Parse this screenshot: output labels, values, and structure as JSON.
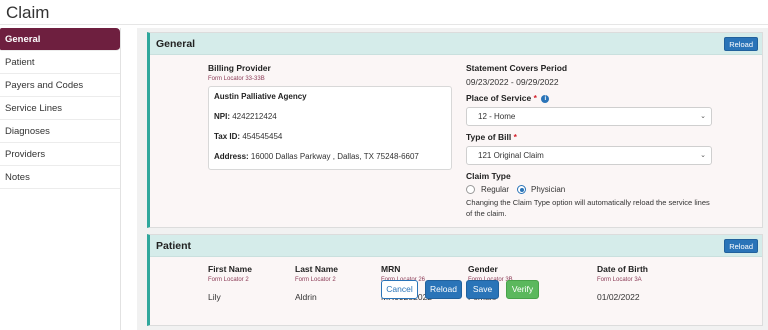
{
  "header": {
    "title": "Claim"
  },
  "sidebar": {
    "items": [
      {
        "label": "General",
        "active": true
      },
      {
        "label": "Patient"
      },
      {
        "label": "Payers and Codes"
      },
      {
        "label": "Service Lines"
      },
      {
        "label": "Diagnoses"
      },
      {
        "label": "Providers"
      },
      {
        "label": "Notes"
      }
    ]
  },
  "general": {
    "title": "General",
    "reload_label": "Reload",
    "billing_provider": {
      "label": "Billing Provider",
      "locator": "Form Locator 33-33B",
      "name": "Austin Palliative Agency",
      "npi_label": "NPI:",
      "npi": "4242212424",
      "tax_label": "Tax ID:",
      "tax_id": "454545454",
      "address_label": "Address:",
      "address": "16000 Dallas Parkway , Dallas, TX 75248-6607"
    },
    "statement_period": {
      "label": "Statement Covers Period",
      "value": "09/23/2022 - 09/29/2022"
    },
    "place_of_service": {
      "label": "Place of Service",
      "required": "*",
      "value": "12 - Home"
    },
    "type_of_bill": {
      "label": "Type of Bill",
      "required": "*",
      "value": "121 Original Claim"
    },
    "claim_type": {
      "label": "Claim Type",
      "options": [
        {
          "label": "Regular",
          "selected": false
        },
        {
          "label": "Physician",
          "selected": true
        }
      ],
      "note": "Changing the Claim Type option will automatically reload the service lines of the claim."
    }
  },
  "patient": {
    "title": "Patient",
    "reload_label": "Reload",
    "fields": [
      {
        "label": "First Name",
        "locator": "Form Locator 2",
        "value": "Lily"
      },
      {
        "label": "Last Name",
        "locator": "Form Locator 2",
        "value": "Aldrin"
      },
      {
        "label": "MRN",
        "locator": "Form Locator 26",
        "value": "MR09282022"
      },
      {
        "label": "Gender",
        "locator": "Form Locator 3B",
        "value": "Female"
      },
      {
        "label": "Date of Birth",
        "locator": "Form Locator 3A",
        "value": "01/02/2022"
      }
    ]
  },
  "footer": {
    "cancel_label": "Cancel",
    "reload_label": "Reload",
    "save_label": "Save",
    "verify_label": "Verify"
  },
  "colors": {
    "accent": "#2a74b8",
    "sidebar_active": "#6e1f3f",
    "panel_header": "#d5ecea",
    "verify": "#5bb85d"
  }
}
